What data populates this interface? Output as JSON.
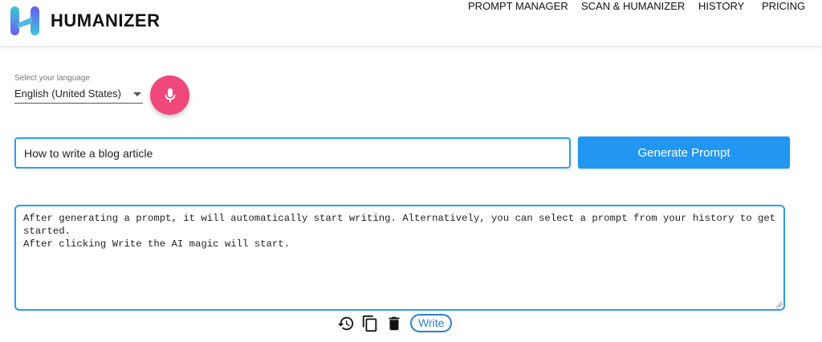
{
  "header": {
    "brand": "HUMANIZER",
    "nav": [
      "PROMPT MANAGER",
      "SCAN & HUMANIZER",
      "HISTORY",
      "PRICING"
    ],
    "logo_colors": [
      "#6a5cf0",
      "#3cc8d8"
    ]
  },
  "language": {
    "label": "Select your language",
    "selected": "English (United States)"
  },
  "mic": {
    "icon": "microphone-icon",
    "color": "#f0487a"
  },
  "prompt": {
    "value": "How to write a blog article"
  },
  "generate_button": {
    "label": "Generate Prompt",
    "color": "#2196f3"
  },
  "output": {
    "text": "After generating a prompt, it will automatically start writing. Alternatively, you can select a prompt from your history to get started.\nAfter clicking Write the AI magic will start."
  },
  "toolbar": {
    "icons": [
      "history-icon",
      "copy-icon",
      "delete-icon"
    ],
    "write_label": "Write"
  }
}
